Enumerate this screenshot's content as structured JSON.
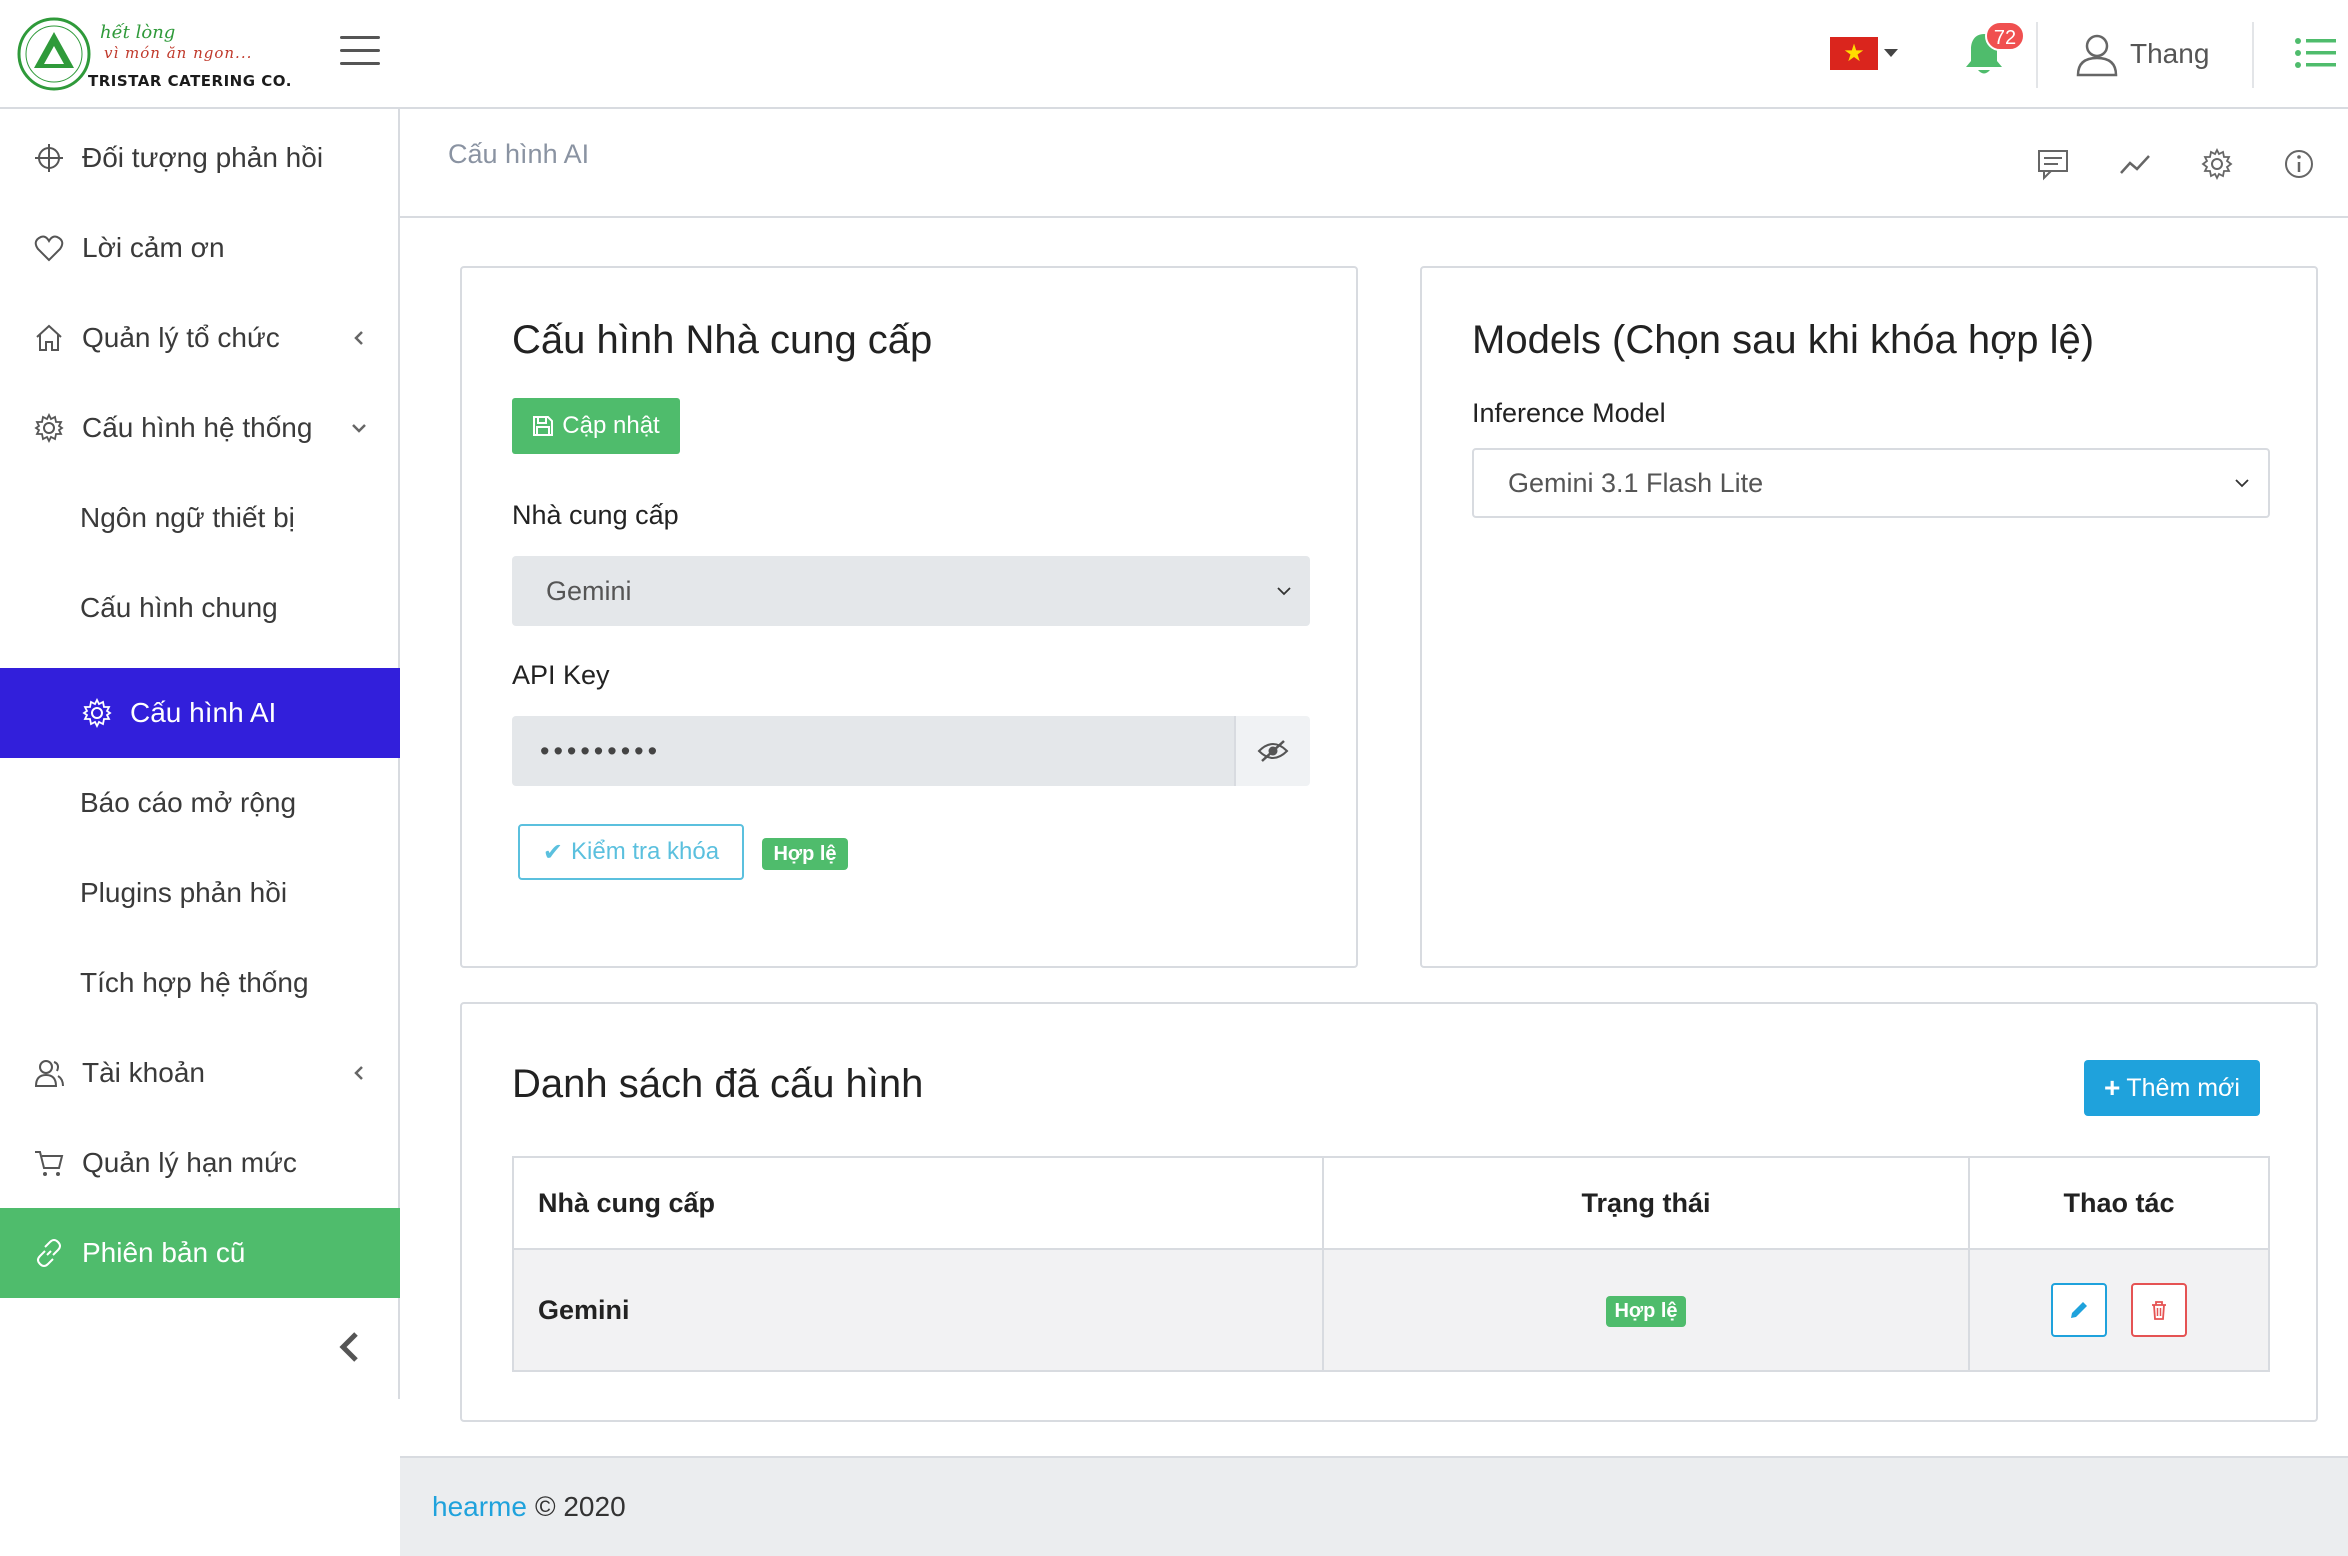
{
  "brand": {
    "tagline_1": "hết lòng",
    "tagline_2": "vì món ăn ngon...",
    "company": "TRISTAR CATERING CO."
  },
  "header": {
    "language_flag": "vietnam-flag",
    "notification_count": "72",
    "user_name": "Thang"
  },
  "sidebar": {
    "items": [
      {
        "label": "Đối tượng phản hồi",
        "icon": "crosshair-icon"
      },
      {
        "label": "Lời cảm ơn",
        "icon": "heart-icon"
      },
      {
        "label": "Quản lý tổ chức",
        "icon": "home-icon"
      },
      {
        "label": "Cấu hình hệ thống",
        "icon": "gear-icon"
      },
      {
        "label": "Ngôn ngữ thiết bị"
      },
      {
        "label": "Cấu hình chung"
      },
      {
        "label": "Cấu hình AI",
        "icon": "gear-icon"
      },
      {
        "label": "Báo cáo mở rộng"
      },
      {
        "label": "Plugins phản hồi"
      },
      {
        "label": "Tích hợp hệ thống"
      },
      {
        "label": "Tài khoản",
        "icon": "users-icon"
      },
      {
        "label": "Quản lý hạn mức",
        "icon": "cart-icon"
      },
      {
        "label": "Phiên bản cũ",
        "icon": "link-icon"
      }
    ]
  },
  "breadcrumb": "Cấu hình AI",
  "provider_card": {
    "title": "Cấu hình Nhà cung cấp",
    "update_button": "Cập nhật",
    "provider_label": "Nhà cung cấp",
    "provider_value": "Gemini",
    "api_key_label": "API Key",
    "api_key_value": "•••••••••",
    "check_button": "Kiểm tra khóa",
    "status_badge": "Hợp lệ"
  },
  "models_card": {
    "title": "Models (Chọn sau khi khóa hợp lệ)",
    "inference_label": "Inference Model",
    "inference_value": "Gemini 3.1 Flash Lite"
  },
  "list_card": {
    "title": "Danh sách đã cấu hình",
    "add_button": "Thêm mới",
    "columns": [
      "Nhà cung cấp",
      "Trạng thái",
      "Thao tác"
    ],
    "rows": [
      {
        "provider": "Gemini",
        "status": "Hợp lệ"
      }
    ]
  },
  "footer": {
    "brand_link": "hearme",
    "copyright": "© 2020"
  },
  "colors": {
    "primary": "#321fdb",
    "success": "#4fbc6c",
    "info": "#1fa2dc",
    "danger": "#e55353"
  }
}
